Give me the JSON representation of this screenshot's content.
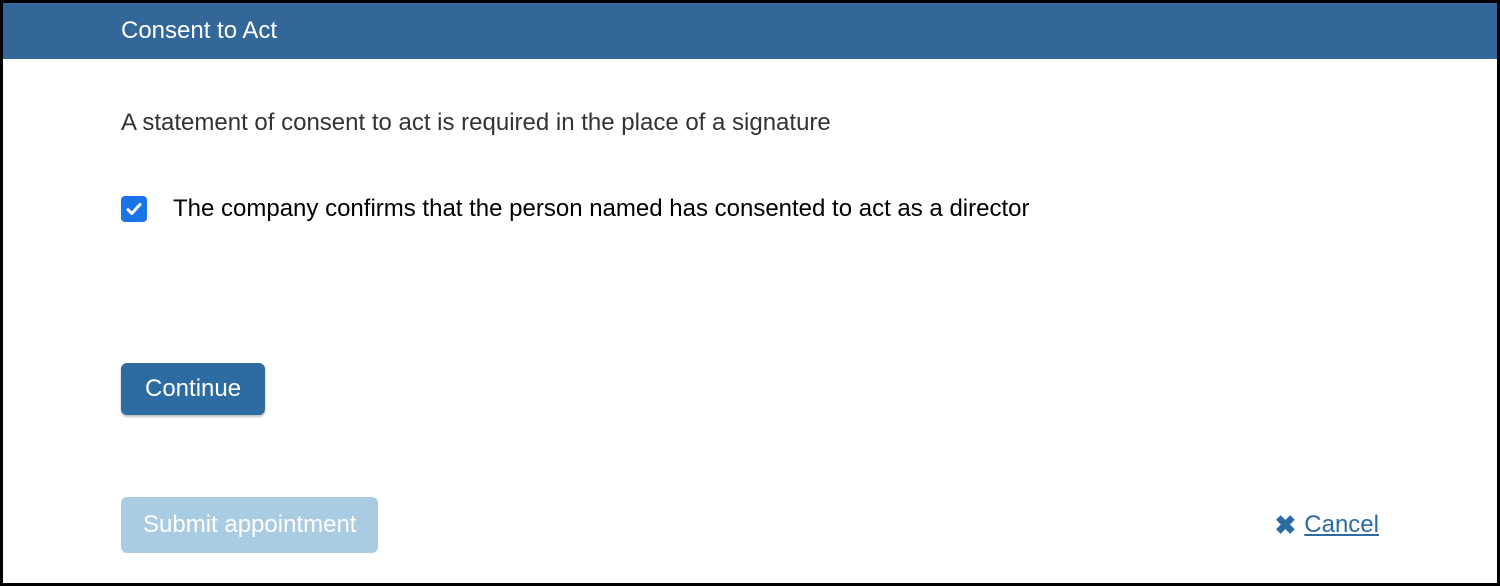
{
  "header": {
    "title": "Consent to Act"
  },
  "intro": "A statement of consent to act is required in the place of a signature",
  "consent": {
    "checked": true,
    "label": "The company confirms that the person named has consented to act as a director"
  },
  "buttons": {
    "continue": "Continue",
    "submit": "Submit appointment",
    "cancel": "Cancel"
  }
}
